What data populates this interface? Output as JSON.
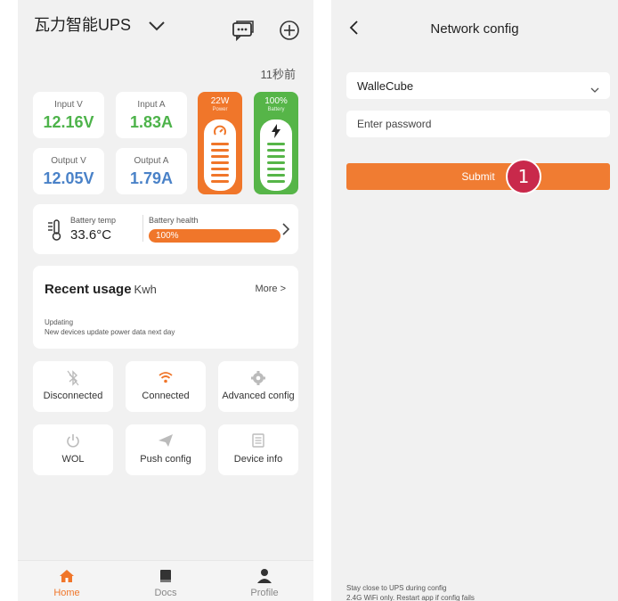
{
  "left_screen": {
    "header": {
      "title": "瓦力智能UPS",
      "dropdown_icon": "chevron-down-icon",
      "message_icon": "chat-icon",
      "add_icon": "plus-circle-icon"
    },
    "timestamp": "11秒前",
    "stats": {
      "input_v": {
        "label": "Input V",
        "value": "12.16V"
      },
      "input_a": {
        "label": "Input A",
        "value": "1.83A"
      },
      "output_v": {
        "label": "Output V",
        "value": "12.05V"
      },
      "output_a": {
        "label": "Output A",
        "value": "1.79A"
      }
    },
    "power_gauge": {
      "value": "22W",
      "label": "Power",
      "color": "#f0762a",
      "icon": "gauge-icon"
    },
    "battery_gauge": {
      "value": "100%",
      "label": "Battery",
      "color": "#56b548",
      "icon": "lightning-icon"
    },
    "battery_info": {
      "temp_label": "Battery temp",
      "temp_value": "33.6°C",
      "health_label": "Battery health",
      "health_value": "100%",
      "health_fraction": 1.0
    },
    "recent_usage": {
      "title": "Recent usage",
      "unit": "Kwh",
      "more": "More >",
      "status": "Updating",
      "note": "New devices update power data next day"
    },
    "tiles": [
      {
        "label": "Disconnected",
        "icon": "bluetooth-off-icon"
      },
      {
        "label": "Connected",
        "icon": "wifi-icon"
      },
      {
        "label": "Advanced config",
        "icon": "gear-icon"
      },
      {
        "label": "WOL",
        "icon": "power-icon"
      },
      {
        "label": "Push config",
        "icon": "send-icon"
      },
      {
        "label": "Device info",
        "icon": "document-icon"
      }
    ],
    "tabs": [
      {
        "label": "Home",
        "icon": "home-icon",
        "active": true
      },
      {
        "label": "Docs",
        "icon": "book-icon",
        "active": false
      },
      {
        "label": "Profile",
        "icon": "person-icon",
        "active": false
      }
    ],
    "colors": {
      "accent": "#f0762a",
      "green": "#4db34a",
      "blue": "#4a82c8"
    }
  },
  "right_screen": {
    "title": "Network config",
    "back_icon": "chevron-left-icon",
    "wifi_select": {
      "value": "WalleCube"
    },
    "password": {
      "placeholder": "Enter password",
      "value": ""
    },
    "submit_label": "Submit",
    "step_badge": "1",
    "hints": [
      "Stay close to UPS during config",
      "2.4G WiFi only. Restart app if config fails"
    ],
    "colors": {
      "submit": "#f07c32",
      "badge": "#c9294b"
    }
  }
}
